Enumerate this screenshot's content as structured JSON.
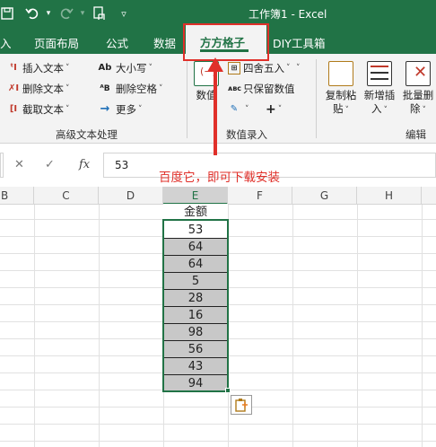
{
  "window": {
    "title": "工作簿1 - Excel"
  },
  "quick_access": {
    "save_icon": "save-icon",
    "undo_icon": "undo-icon",
    "redo_icon": "redo-icon",
    "touch_icon": "touch-mode-icon",
    "customize_icon": "customize-icon"
  },
  "colors": {
    "brand": "#217346",
    "highlight": "#e0302a",
    "shaded": "#c8c8c8"
  },
  "tabs": [
    {
      "label": "入"
    },
    {
      "label": "页面布局"
    },
    {
      "label": "公式"
    },
    {
      "label": "数据"
    },
    {
      "label": "方方格子"
    },
    {
      "label": "DIY工具箱"
    }
  ],
  "ribbon": {
    "text_group": {
      "insert_text": "插入文本",
      "delete_text": "删除文本",
      "extract_text": "截取文本",
      "case": "大小写",
      "delete_space": "删除空格",
      "more": "更多",
      "label": "高级文本处理"
    },
    "number_group": {
      "value_btn": "数值",
      "round": "四舍五入",
      "keep_value": "只保留数值",
      "plus": "+",
      "label": "数值录入"
    },
    "edit_group": {
      "copy_paste_l1": "复制粘",
      "copy_paste_l2": "贴",
      "new_insert_l1": "新增插",
      "new_insert_l2": "入",
      "batch_delete_l1": "批量删",
      "batch_delete_l2": "除",
      "label": "编辑"
    }
  },
  "formula_bar": {
    "cancel": "✕",
    "enter": "✓",
    "fx": "fx",
    "value": "53"
  },
  "annotation": "百度它，即可下载安装",
  "columns": [
    "B",
    "C",
    "D",
    "E",
    "F",
    "G",
    "H"
  ],
  "column_e": {
    "header": "金额",
    "values": [
      "53",
      "64",
      "64",
      "5",
      "28",
      "16",
      "98",
      "56",
      "43",
      "94"
    ]
  }
}
